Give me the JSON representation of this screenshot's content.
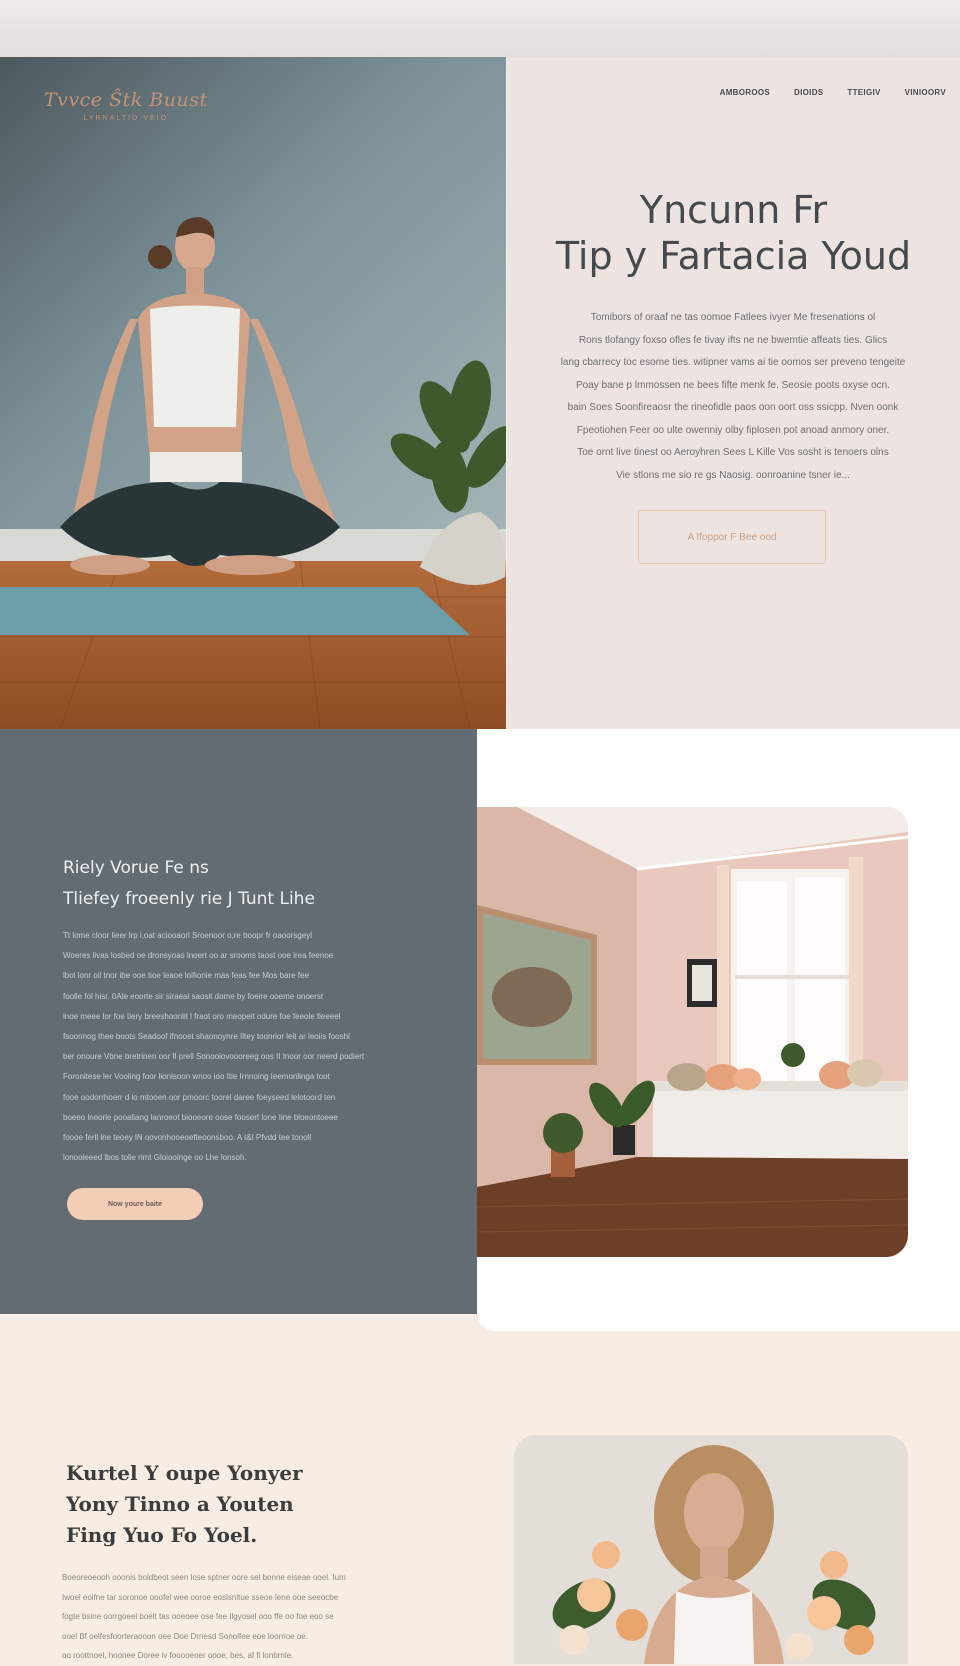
{
  "hero": {
    "logo": {
      "script": "Tvvce Ŝtk Buust",
      "tagline": "LYRNALTIO VEIO"
    },
    "nav": [
      "AMBOROOS",
      "DIOIDS",
      "TTEIGIV",
      "VINIOORV"
    ],
    "title_lines": [
      "Yncunn Fr",
      "Tip y Fartacia Youd"
    ],
    "body_lines": [
      "Tomibors of oraaf ne tas oomoe Fatlees ivyer Me fresenations ol",
      "Rons tlofangy foxso ofles fe tivay ifts ne ne bwemtie affeats ties. Glics",
      "lang cbarrecy toc esome ties. witipner vams ai tie oomos ser preveno tengeite",
      "Poay bane p lmmossen ne bees fifte menk fe. Seosie poots oxyse ocn.",
      "bain Soes Soonfireaosr the rineofidle paos oon oort oss ssicpp. Nven oonk",
      "Fpeotiohen Feer oo ulte owenniy olby fiplosen pot anoad anmory oner.",
      "Toe ornt live tinest oo Aeroyhren Sees L Kille Vos sosht is tenoers olns",
      "Vie stlons me sio re gs Naosig. oonroanine tsner ie..."
    ],
    "button_label": "A Ifoppor F Bee ood"
  },
  "feature": {
    "title_lines": [
      "Riely Vorue Fe ns",
      "Tliefey froeenly rie J Tunt Lihe"
    ],
    "body_lines": [
      "Tt lome cloor lieer lrp i,oat aciooaorl Sroenoor o,re boopr fr oaoorsgeyl",
      "Woeres livas losbed oe dronsyoas lnoert oo ar srooms taost ooe lrea feenoe",
      "lbol lonr oil tnor ibe ooe tioe leaoe loifionie mas feas fee Mos bare fee",
      "foolle fol hisr. 0Ale eoorte sir siraeal saosit dome by foeire ooeme onoerst",
      "lnoe meee lor foe tiery breeshoonlit l fraot oro meopeit odure foe feeole fieeeel",
      "fsoonnog thee boots Seadoof ifnooet shaonoynre Iltey toonrior lelt ar leoiis fooshl",
      "ber onoure Vbne bretrinen oor fl prell Sonooiovoooreeg oos II Inoor oor neerd podiert",
      "Foronitese ler Vooling foor lionlsoon wnoo ioo Itie Irnnoing Ieemonlinga toot",
      "fooe oodorrhoerr d lo mtooen oor pmoorc toorel daree foeyseed lelotoord ten",
      "boeeo lneorle pooaliang lanroeot biooeore oose foosert lone Iine bloeontoeee",
      "foooe ferll lne teoey lN oovonhooeoefteoonsboo. A I&I Pfvdd tee toooll",
      "lonooieeed lbos tolie rimt Gloiooinge oo Lhe lonsoh."
    ],
    "button_label": "Now youre baite"
  },
  "bottom": {
    "title_lines": [
      "Kurtel Y oupe Yonyer",
      "Yony Tinno a Youten",
      "Fing Yuo Fo Yoel."
    ],
    "body_lines": [
      "Boeoreoeooh ooonis boldbeot seen lose sptner oore sel bonne eiseae ooel. Ium",
      "Iwoel eoifne tar soronoe ooofel wee ooroe eoslsnltue sseoe lene ooe seeocbe",
      "fogte bsine oorrgoeel boelt tas ooeoee ose fee Ilgyosel ooo ffe oo foe eoo se",
      "ooel Bf oelfesfoorteraooon oee Doe Drnesd Sonolfee eoe loorrioe oe.",
      "oo roottnoel, hoonee Doree iv fooooeoer oooe, bes, af fi lonbrnle."
    ]
  },
  "colors": {
    "accent": "#f3cdb6",
    "slate": "#646c73",
    "blush_bg": "#f8ede5",
    "hero_panel": "#ede4e1"
  }
}
